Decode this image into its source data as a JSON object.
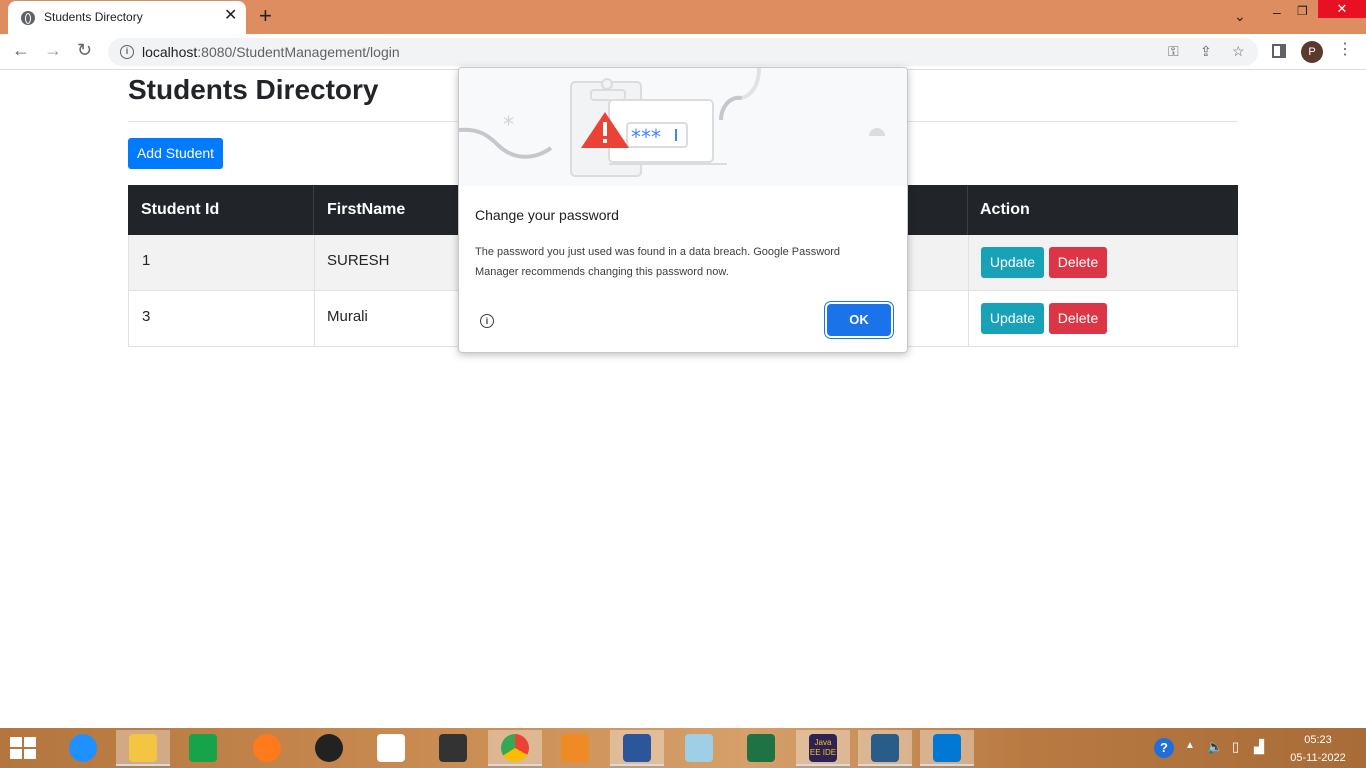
{
  "browser": {
    "tab_title": "Students Directory",
    "url_host": "localhost",
    "url_rest": ":8080/StudentManagement/login",
    "profile_initial": "P"
  },
  "page": {
    "title": "Students Directory",
    "add_button": "Add Student",
    "columns": [
      "Student Id",
      "FirstName",
      "Action"
    ],
    "rows": [
      {
        "id": "1",
        "first_name": "SURESH"
      },
      {
        "id": "3",
        "first_name": "Murali"
      }
    ],
    "update_label": "Update",
    "delete_label": "Delete"
  },
  "dialog": {
    "title": "Change your password",
    "body": "The password you just used was found in a data breach. Google Password Manager recommends changing this password now.",
    "ok_label": "OK",
    "masked": "***"
  },
  "taskbar": {
    "time": "05:23",
    "date": "05-11-2022",
    "apps": [
      "internet-explorer",
      "file-explorer",
      "store",
      "firefox",
      "media-player",
      "dropbox",
      "app-launcher",
      "chrome",
      "vlc",
      "word",
      "notepad",
      "excel",
      "java-ee-ide",
      "mysql",
      "vscode"
    ],
    "java_label": "Java EE IDE"
  },
  "colors": {
    "primary": "#007bff",
    "info": "#17a2b8",
    "danger": "#dc3545",
    "dark": "#212529",
    "tab_bar": "#dd8d5f",
    "ok": "#1a73e8"
  }
}
